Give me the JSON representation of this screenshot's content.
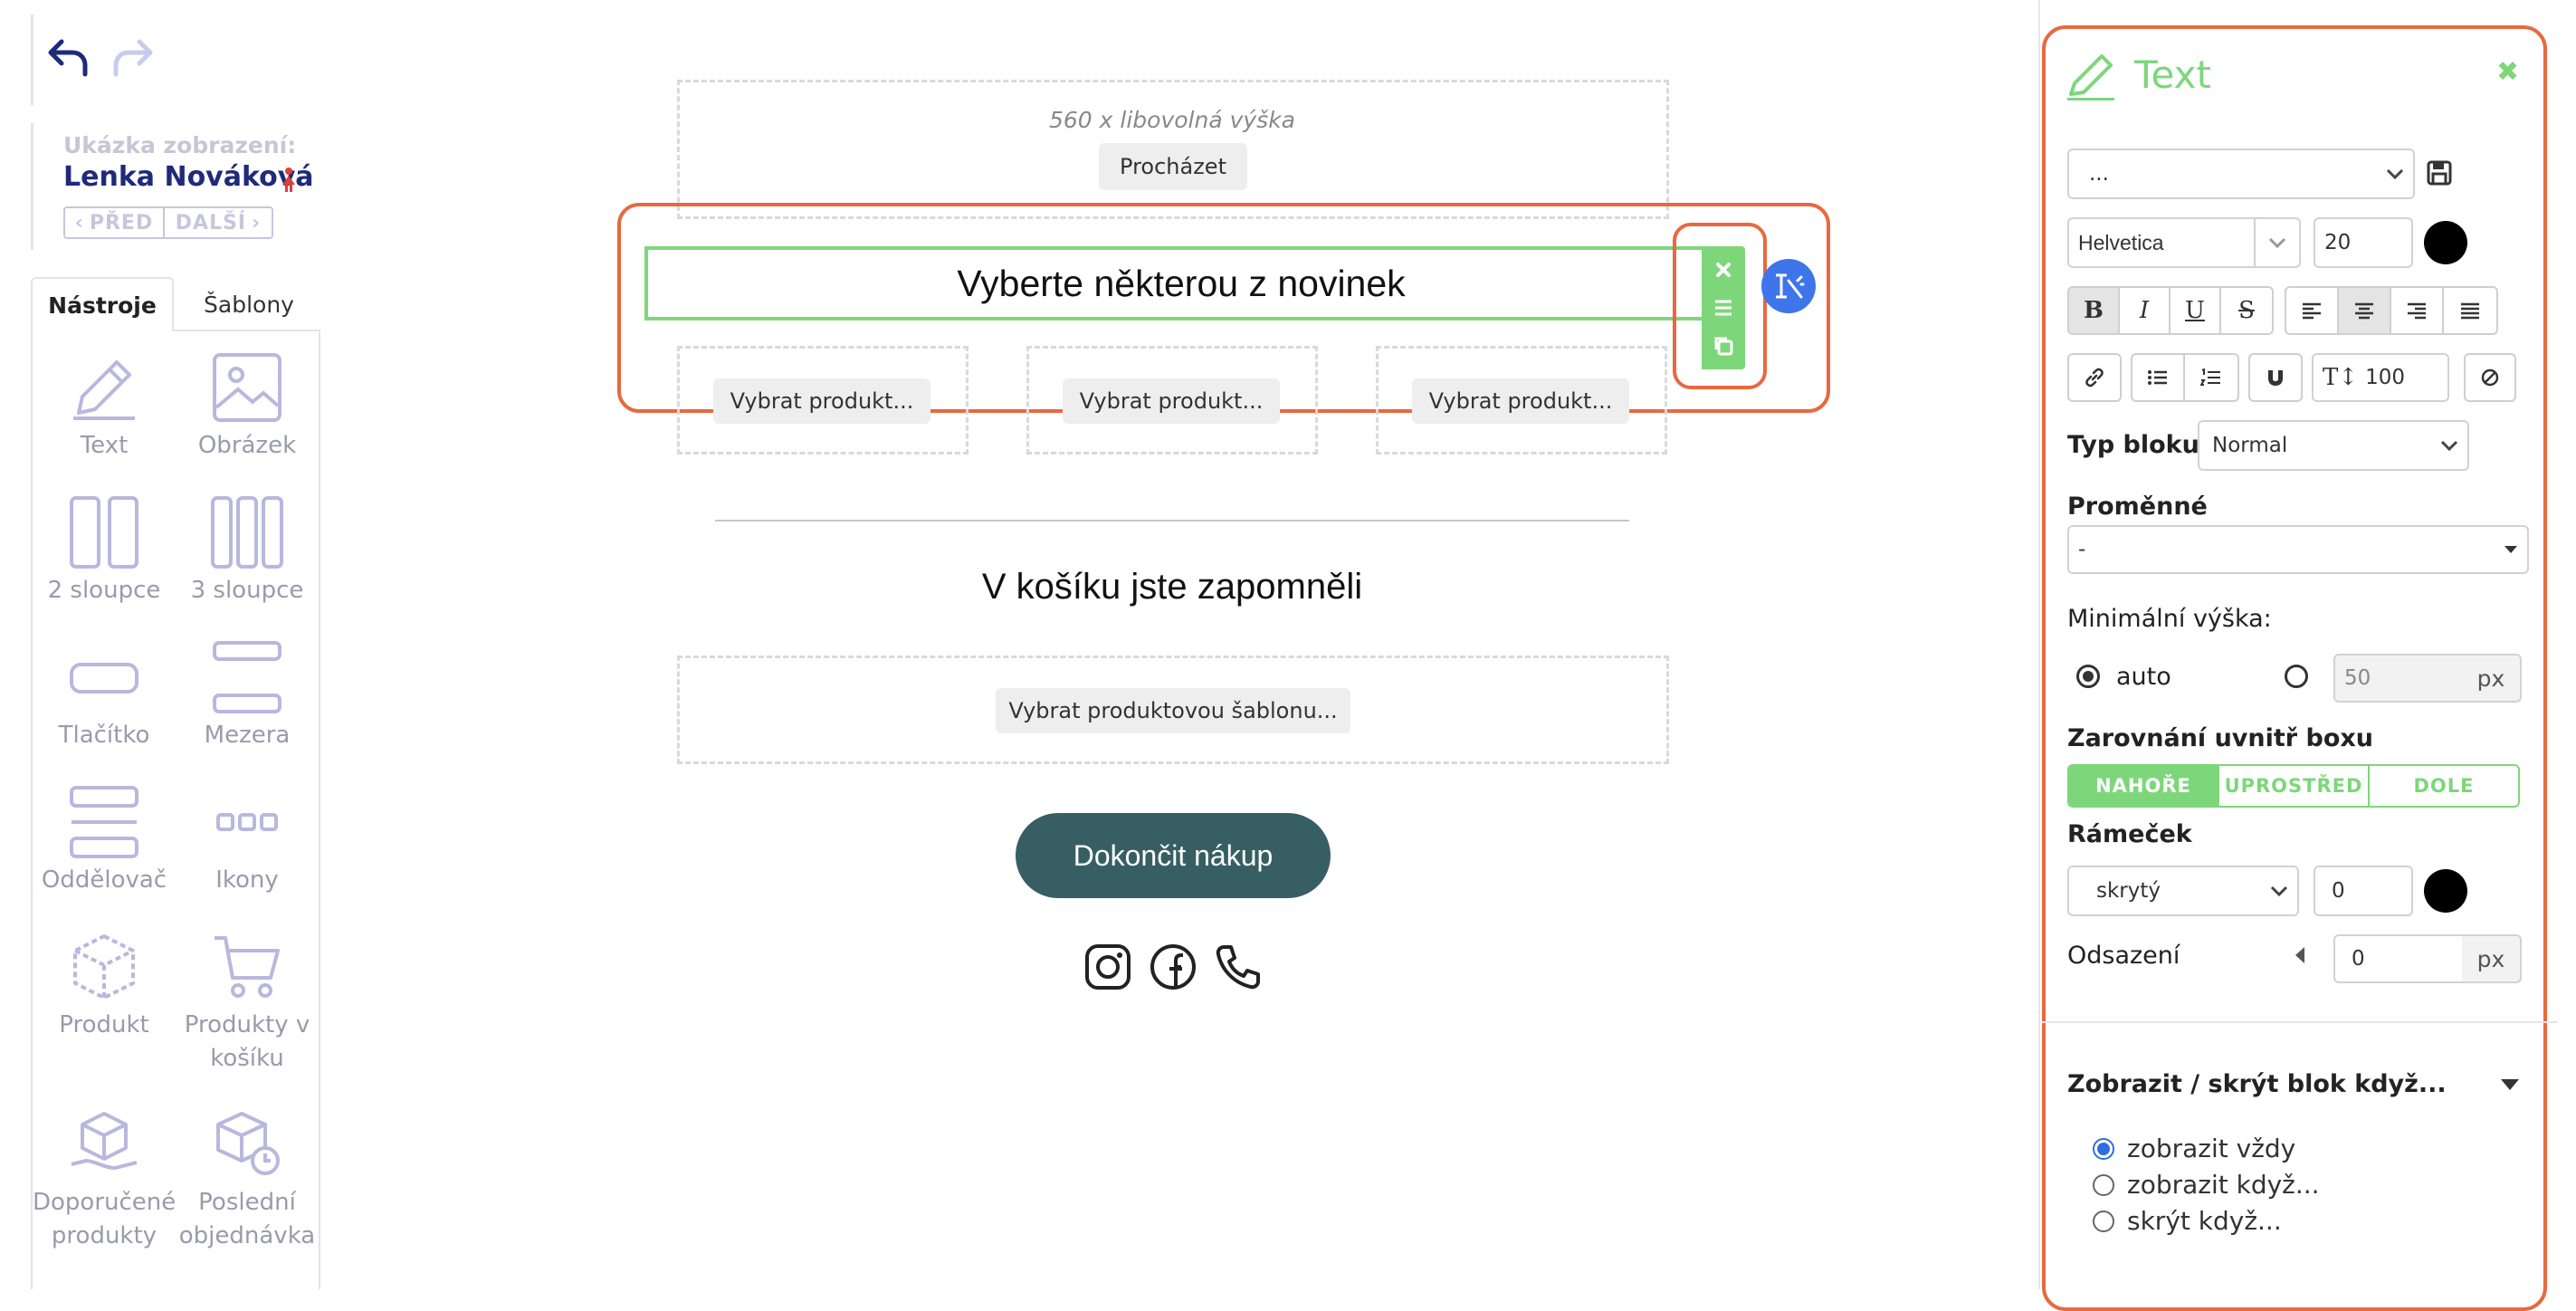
{
  "preview": {
    "label": "Ukázka zobrazení:",
    "name": "Lenka Nováková",
    "prev": "PŘED",
    "next": "DALŠÍ"
  },
  "tabs": {
    "tools": "Nástroje",
    "templates": "Šablony"
  },
  "tools": [
    {
      "label": "Text"
    },
    {
      "label": "Obrázek"
    },
    {
      "label": "2 sloupce"
    },
    {
      "label": "3 sloupce"
    },
    {
      "label": "Tlačítko"
    },
    {
      "label": "Mezera"
    },
    {
      "label": "Oddělovač"
    },
    {
      "label": "Ikony"
    },
    {
      "label": "Produkt"
    },
    {
      "label": "Produkty v košíku"
    },
    {
      "label": "Doporučené produkty"
    },
    {
      "label": "Poslední objednávka"
    }
  ],
  "canvas": {
    "image_hint": "560 x libovolná výška",
    "browse": "Procházet",
    "text_block": "Vyberte některou z novinek",
    "select_product": "Vybrat produkt...",
    "heading": "V košíku jste zapomněli",
    "select_template": "Vybrat produktovou šablonu...",
    "cta": "Dokončit nákup"
  },
  "panel": {
    "title": "Text",
    "style_select": "...",
    "font": "Helvetica",
    "font_size": "20",
    "line_height": "100",
    "block_type_label": "Typ bloku:",
    "block_type": "Normal",
    "variables_label": "Proměnné",
    "variables_value": "-",
    "min_height_label": "Minimální výška:",
    "auto_label": "auto",
    "min_height_value": "50",
    "px": "px",
    "align_label": "Zarovnání uvnitř boxu",
    "align_top": "NAHOŘE",
    "align_middle": "UPROSTŘED",
    "align_bottom": "DOLE",
    "border_label": "Rámeček",
    "border_style": "skrytý",
    "border_width": "0",
    "padding_label": "Odsazení",
    "padding_value": "0",
    "visibility_title": "Zobrazit / skrýt blok když...",
    "vis_always": "zobrazit vždy",
    "vis_when": "zobrazit když...",
    "vis_hide": "skrýt když..."
  },
  "colors": {
    "accent_green": "#7ed67a",
    "highlight_orange": "#e8693f",
    "cta_teal": "#375f63",
    "magic_blue": "#3e75ea"
  }
}
